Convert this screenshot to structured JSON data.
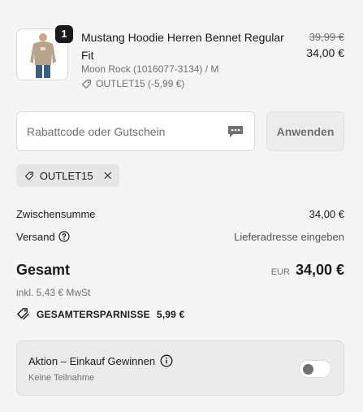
{
  "product": {
    "title": "Mustang Hoodie Herren Bennet Regular Fit",
    "quantity": "1",
    "old_price": "39,99 €",
    "price": "34,00 €",
    "variant": "Moon Rock (1016077-3134) / M",
    "discount": "OUTLET15 (-5,99 €)",
    "image_icon": "hoodie-product-image"
  },
  "discount_form": {
    "placeholder": "Rabattcode oder Gutschein",
    "value": "",
    "apply_label": "Anwenden"
  },
  "applied_code": {
    "label": "OUTLET15"
  },
  "summary": {
    "subtotal_label": "Zwischensumme",
    "subtotal_value": "34,00 €",
    "shipping_label": "Versand",
    "shipping_value": "Lieferadresse eingeben",
    "total_label": "Gesamt",
    "currency": "EUR",
    "total_value": "34,00 €",
    "tax_note": "inkl. 5,43 € MwSt",
    "savings_label": "GESAMTERSPARNISSE",
    "savings_value": "5,99 €"
  },
  "action": {
    "title": "Aktion – Einkauf Gewinnen",
    "subtitle": "Keine Teilnahme",
    "toggle_on": false
  },
  "colors": {
    "background": "#f5f5f5",
    "text": "#1a1a1a",
    "muted": "#707070"
  }
}
